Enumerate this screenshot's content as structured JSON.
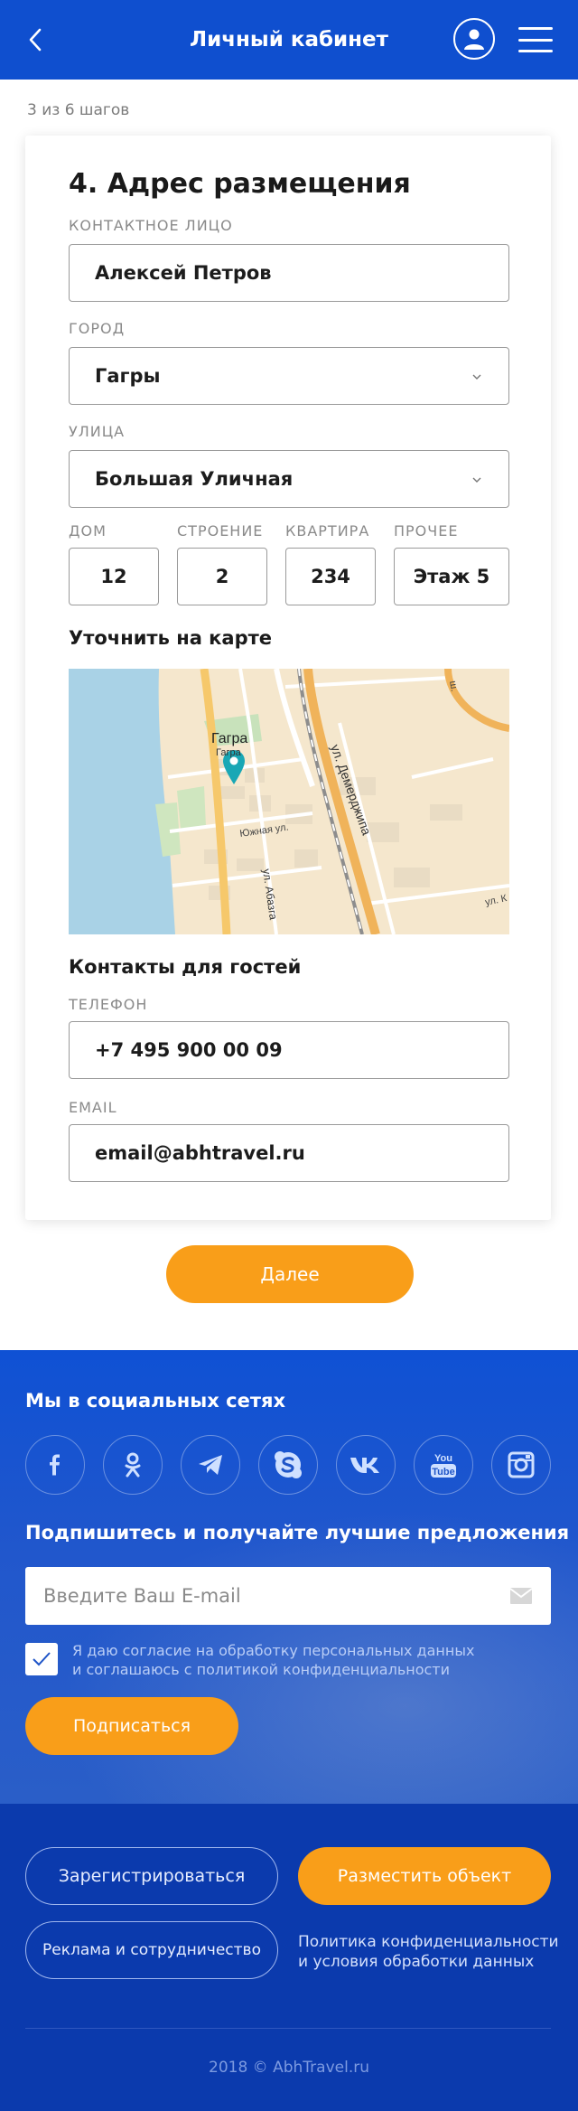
{
  "header": {
    "title": "Личный кабинет",
    "back_icon": "chevron-left-icon",
    "profile_icon": "user-icon",
    "menu_icon": "burger-menu-icon"
  },
  "progress": {
    "text": "3 из 6 шагов",
    "current_step": 3,
    "total_steps": 6
  },
  "form": {
    "title": "4. Адрес размещения",
    "contact": {
      "label": "КОНТАКТНОЕ ЛИЦО",
      "value": "Алексей Петров"
    },
    "city": {
      "label": "ГОРОД",
      "value": "Гагры"
    },
    "street": {
      "label": "УЛИЦА",
      "value": "Большая Уличная"
    },
    "house": {
      "label": "ДОМ",
      "value": "12"
    },
    "building": {
      "label": "СТРОЕНИЕ",
      "value": "2"
    },
    "apartment": {
      "label": "КВАРТИРА",
      "value": "234"
    },
    "other": {
      "label": "ПРОЧЕЕ",
      "value": "Этаж 5"
    },
    "map_title": "Уточнить на карте",
    "map": {
      "city_label": "Гагра",
      "city_sublabel": "Гагра",
      "street_1": "ул. Демерджипа",
      "street_2": "Южная ул.",
      "street_3": "ул. Абазга",
      "street_4": "ул. К",
      "street_5": "ш."
    },
    "contacts_title": "Контакты для гостей",
    "phone": {
      "label": "ТЕЛЕФОН",
      "value": "+7 495 900 00 09"
    },
    "email": {
      "label": "EMAIL",
      "value": "email@abhtravel.ru"
    }
  },
  "next_button": "Далее",
  "footer": {
    "social_title": "Мы в социальных сетях",
    "social_icons": [
      "facebook-icon",
      "odnoklassniki-icon",
      "telegram-icon",
      "skype-icon",
      "vk-icon",
      "youtube-icon",
      "instagram-icon"
    ],
    "youtube_text_1": "You",
    "youtube_text_2": "Tube",
    "subscribe_title": "Подпишитесь и получайте лучшие предложения",
    "email_placeholder": "Введите Ваш E-mail",
    "consent_checked": true,
    "consent_line1": "Я даю согласие на обработку персональных данных",
    "consent_line2": "и соглашаюсь с политикой конфиденциальности",
    "subscribe_button": "Подписаться",
    "register_button": "Зарегистрироваться",
    "place_object_button": "Разместить объект",
    "ads_button": "Реклама и сотрудничество",
    "policy_line1": "Политика конфиденциальности",
    "policy_line2": "и условия обработки данных",
    "copyright": "2018 © AbhTravel.ru"
  },
  "colors": {
    "header_blue": "#0f4fcf",
    "accent_orange": "#f99e19",
    "footer_dark_blue": "#0b3aad",
    "map_pin": "#19a7b5"
  }
}
